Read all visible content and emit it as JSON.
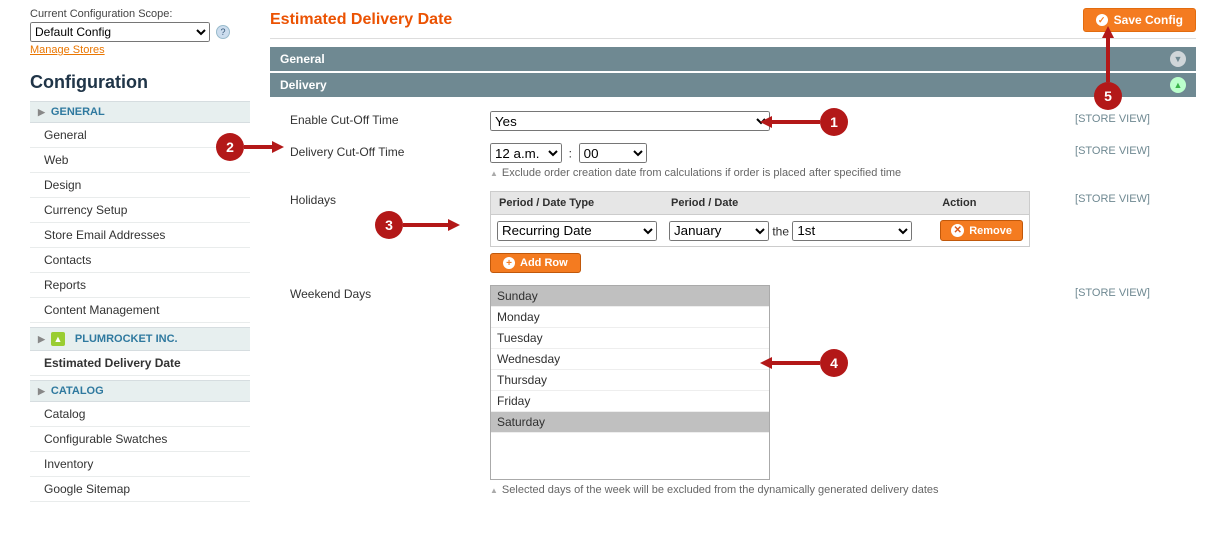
{
  "sidebar": {
    "scope_label": "Current Configuration Scope:",
    "scope_value": "Default Config",
    "manage_stores": "Manage Stores",
    "config_title": "Configuration",
    "sections": [
      {
        "title": "GENERAL",
        "items": [
          "General",
          "Web",
          "Design",
          "Currency Setup",
          "Store Email Addresses",
          "Contacts",
          "Reports",
          "Content Management"
        ]
      },
      {
        "title": "PLUMROCKET INC.",
        "items": [
          "Estimated Delivery Date"
        ],
        "active_index": 0
      },
      {
        "title": "CATALOG",
        "items": [
          "Catalog",
          "Configurable Swatches",
          "Inventory",
          "Google Sitemap"
        ]
      }
    ]
  },
  "page": {
    "title": "Estimated Delivery Date",
    "save_label": "Save Config"
  },
  "fieldsets": {
    "general_title": "General",
    "delivery_title": "Delivery"
  },
  "form": {
    "enable_label": "Enable Cut-Off Time",
    "enable_value": "Yes",
    "cutoff_label": "Delivery Cut-Off Time",
    "cutoff_hour": "12 a.m.",
    "cutoff_minute": "00",
    "cutoff_note": "Exclude order creation date from calculations if order is placed after specified time",
    "holidays_label": "Holidays",
    "holidays_th1": "Period / Date Type",
    "holidays_th2": "Period / Date",
    "holidays_th3": "Action",
    "holiday_type": "Recurring Date",
    "holiday_month": "January",
    "holiday_the": "the",
    "holiday_day": "1st",
    "remove_label": "Remove",
    "addrow_label": "Add Row",
    "weekend_label": "Weekend Days",
    "days": [
      "Sunday",
      "Monday",
      "Tuesday",
      "Wednesday",
      "Thursday",
      "Friday",
      "Saturday"
    ],
    "selected_days": [
      "Sunday",
      "Saturday"
    ],
    "weekend_note": "Selected days of the week will be excluded from the dynamically generated delivery dates",
    "store_view": "[STORE VIEW]"
  },
  "callouts": [
    "1",
    "2",
    "3",
    "4",
    "5"
  ]
}
